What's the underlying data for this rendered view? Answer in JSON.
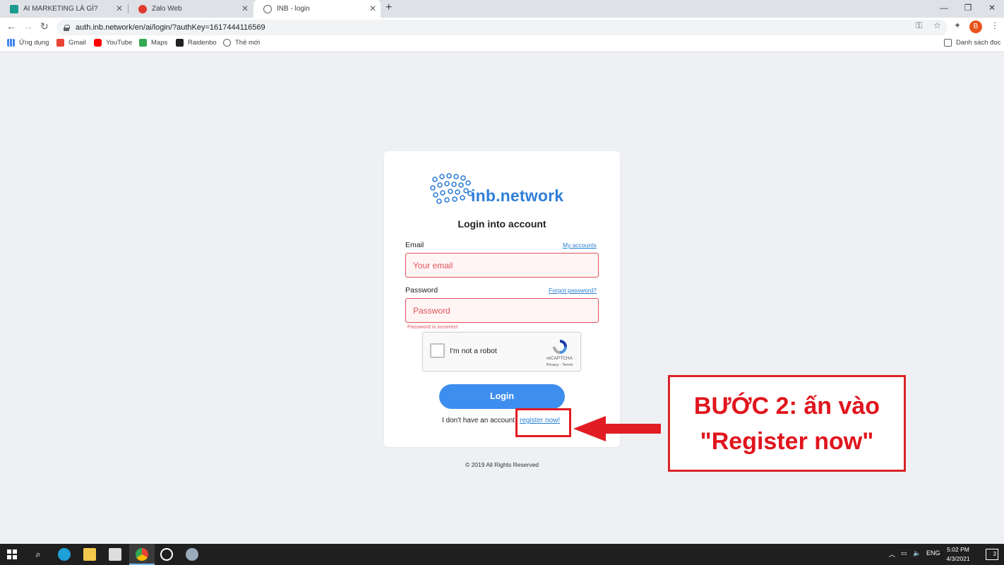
{
  "browser": {
    "tabs": [
      {
        "label": "AI MARKETING LÀ GÌ?",
        "icon": "ai-marketing-favicon",
        "active": false
      },
      {
        "label": "Zalo Web",
        "icon": "zalo-favicon",
        "active": false
      },
      {
        "label": "INB - login",
        "icon": "globe-icon",
        "active": true
      }
    ],
    "new_tab": "+",
    "window_controls": {
      "minimize": "—",
      "restore": "❐",
      "close": "✕"
    },
    "url": "auth.inb.network/en/ai/login/?authKey=1617444116569",
    "profile_initial": "B",
    "bookmarks": [
      {
        "label": "Ứng dụng",
        "icon": "apps-grid-icon",
        "color": "#4285f4"
      },
      {
        "label": "Gmail",
        "icon": "gmail-icon",
        "color": "#ea4335"
      },
      {
        "label": "YouTube",
        "icon": "youtube-icon",
        "color": "#ff0000"
      },
      {
        "label": "Maps",
        "icon": "maps-icon",
        "color": "#34a853"
      },
      {
        "label": "Raidenbo",
        "icon": "raidenbo-icon",
        "color": "#222222"
      },
      {
        "label": "Thẻ mới",
        "icon": "globe-icon",
        "color": "#5f6368"
      }
    ],
    "reading_list": "Danh sách đọc"
  },
  "login": {
    "brand": "inb.network",
    "title": "Login into account",
    "email_label": "Email",
    "my_accounts": "My accounts",
    "email_placeholder": "Your email",
    "password_label": "Password",
    "forgot_password": "Forgot password?",
    "password_placeholder": "Password",
    "password_error": "Password is incorrect",
    "captcha_text": "I'm not a robot",
    "captcha_brand": "reCAPTCHA",
    "captcha_terms": "Privacy - Terms",
    "login_button": "Login",
    "no_account_text": "I don't have an account",
    "register_link": "register now!",
    "footer": "© 2019 All Rights Reserved"
  },
  "annotation": {
    "line1": "BƯỚC 2: ấn vào",
    "line2": "\"Register now\"",
    "color": "#e0151d"
  },
  "taskbar": {
    "language": "ENG",
    "time": "5:02 PM",
    "date": "4/3/2021",
    "notification_count": "3"
  },
  "colors": {
    "accent": "#3e8ef0",
    "error": "#e0555c",
    "link": "#2a7fd4"
  }
}
